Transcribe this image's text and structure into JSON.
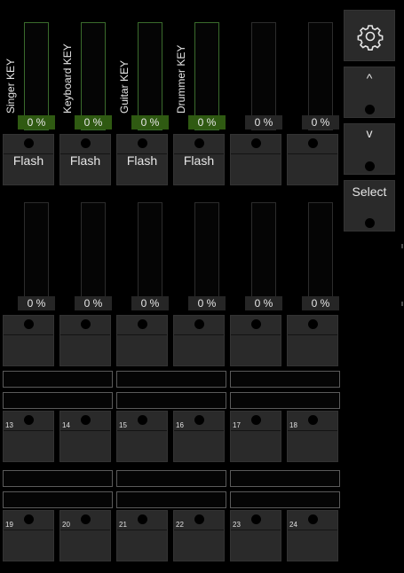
{
  "side": {
    "settings_icon": "gear-icon",
    "up_label": "^",
    "down_label": "v",
    "select_label": "Select"
  },
  "bank1": {
    "faders": [
      {
        "label": "Singer KEY",
        "percent": "0 %",
        "level": 0,
        "keyed": true
      },
      {
        "label": "Keyboard KEY",
        "percent": "0 %",
        "level": 0,
        "keyed": true
      },
      {
        "label": "Guitar KEY",
        "percent": "0 %",
        "level": 0,
        "keyed": true
      },
      {
        "label": "Drummer KEY",
        "percent": "0 %",
        "level": 0,
        "keyed": true
      },
      {
        "label": "",
        "percent": "0 %",
        "level": 0,
        "keyed": false
      },
      {
        "label": "",
        "percent": "0 %",
        "level": 0,
        "keyed": false
      }
    ],
    "buttons": [
      "Flash",
      "Flash",
      "Flash",
      "Flash",
      "",
      ""
    ]
  },
  "bank2": {
    "faders": [
      {
        "percent": "0 %",
        "level": 0
      },
      {
        "percent": "0 %",
        "level": 0
      },
      {
        "percent": "0 %",
        "level": 0
      },
      {
        "percent": "0 %",
        "level": 0
      },
      {
        "percent": "0 %",
        "level": 0
      },
      {
        "percent": "0 %",
        "level": 0
      }
    ],
    "buttons": [
      "",
      "",
      "",
      "",
      "",
      ""
    ]
  },
  "grid1": {
    "name_fields": [
      "",
      "",
      "",
      "",
      "",
      ""
    ],
    "buttons": [
      "13",
      "14",
      "15",
      "16",
      "17",
      "18"
    ]
  },
  "grid2": {
    "name_fields": [
      "",
      "",
      "",
      "",
      "",
      ""
    ],
    "buttons": [
      "19",
      "20",
      "21",
      "22",
      "23",
      "24"
    ]
  },
  "colors": {
    "key_percent_bg": "#2f5a12",
    "key_border": "#3a6b2c",
    "tile_bg": "#2a2a2a",
    "background": "#000000"
  }
}
